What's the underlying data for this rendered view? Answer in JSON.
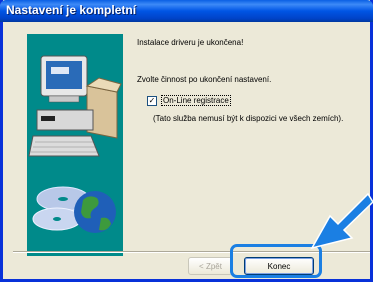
{
  "window": {
    "title": "Nastavení je kompletní"
  },
  "content": {
    "line1": "Instalace driveru je ukončena!",
    "line2": "Zvolte činnost po ukončení nastavení.",
    "checkbox": {
      "label": "On-Line registrace",
      "checked": true
    },
    "line3": "(Tato služba nemusí být k dispozici ve všech zemích)."
  },
  "buttons": {
    "back_label": "< Zpět",
    "finish_label": "Konec"
  },
  "colors": {
    "title_bar": "#0055e5",
    "dialog_bg": "#ece9d8",
    "highlight": "#1b7fe3",
    "graphic_bg": "#008a8a"
  }
}
